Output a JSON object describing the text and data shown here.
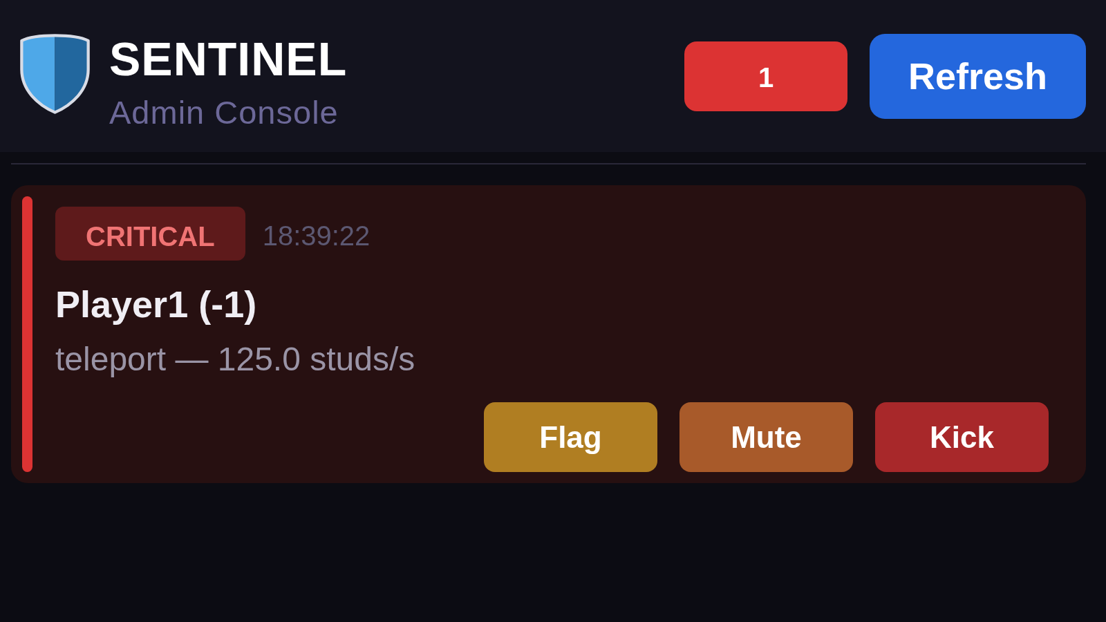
{
  "header": {
    "title": "SENTINEL",
    "subtitle": "Admin Console",
    "alert_count": "1",
    "refresh_button": "Refresh"
  },
  "alerts": [
    {
      "kind": "critical",
      "severity_label": "CRITICAL",
      "time": "18:39:22",
      "player": "Player1 (-1)",
      "detail": "teleport — 125.0 studs/s",
      "actions": [
        {
          "label": "Flag",
          "kind": "flag"
        },
        {
          "label": "Mute",
          "kind": "mute"
        },
        {
          "label": "Kick",
          "kind": "kick"
        }
      ]
    }
  ]
}
